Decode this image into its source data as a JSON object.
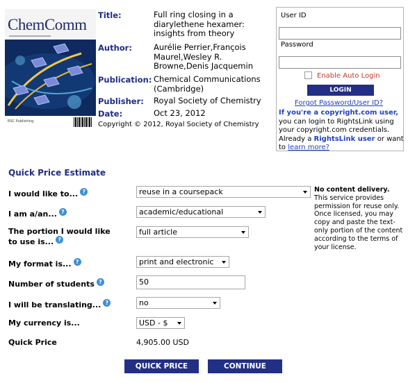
{
  "cover": {
    "journal_title": "ChemComm",
    "publisher_mark": "RSC Publishing"
  },
  "article": {
    "labels": {
      "title": "Title:",
      "author": "Author:",
      "publication": "Publication:",
      "publisher": "Publisher:",
      "date": "Date:"
    },
    "title": "Full ring closing in a diarylethene hexamer: insights from theory",
    "author": "Aurélie Perrier,François Maurel,Wesley R. Browne,Denis Jacquemin",
    "publication": "Chemical Communications (Cambridge)",
    "publisher": "Royal Society of Chemistry",
    "date": "Oct 23, 2012",
    "copyright": "Copyright © 2012, Royal Society of Chemistry"
  },
  "login": {
    "user_id_label": "User ID",
    "user_id_value": "",
    "password_label": "Password",
    "password_value": "",
    "auto_login_label": "Enable Auto Login",
    "auto_login_checked": false,
    "login_button": "LOGIN",
    "forgot_link": "Forgot Password/User ID?",
    "info_bold": "If you're a copyright.com user,",
    "info_text": " you can login to RightsLink using your copyright.com credentials.",
    "already_text": "Already a ",
    "already_bold": "RightsLink user",
    "or_want_text": " or want to ",
    "learn_more": "learn more?"
  },
  "quick_price": {
    "section_title": "Quick Price Estimate",
    "help_glyph": "?",
    "would_like_label": "I would like to...",
    "would_like_value": "reuse in a coursepack",
    "am_a_label": "I am a/an...",
    "am_a_value": "academic/educational",
    "portion_label_line1": "The portion I would like",
    "portion_label_line2": "to use is...",
    "portion_value": "full article",
    "format_label": "My format is...",
    "format_value": "print and electronic",
    "students_label": "Number of students",
    "students_value": "50",
    "translating_label": "I will be translating...",
    "translating_value": "no",
    "currency_label": "My currency is...",
    "currency_value": "USD - $",
    "price_label": "Quick Price",
    "price_value": "4,905.00 USD",
    "note_bold": "No content delivery.",
    "note_text": " This service provides permission for reuse only. Once licensed, you may copy and paste the text-only portion of the content according to the terms of your license."
  },
  "buttons": {
    "quick_price": "QUICK PRICE",
    "continue": "CONTINUE"
  },
  "colors": {
    "label_blue": "#1f2c8a",
    "button_navy": "#232f85",
    "link_blue": "#1f3fbf",
    "auto_login_red": "#c0392b",
    "help_icon_blue": "#3d8fd6"
  }
}
